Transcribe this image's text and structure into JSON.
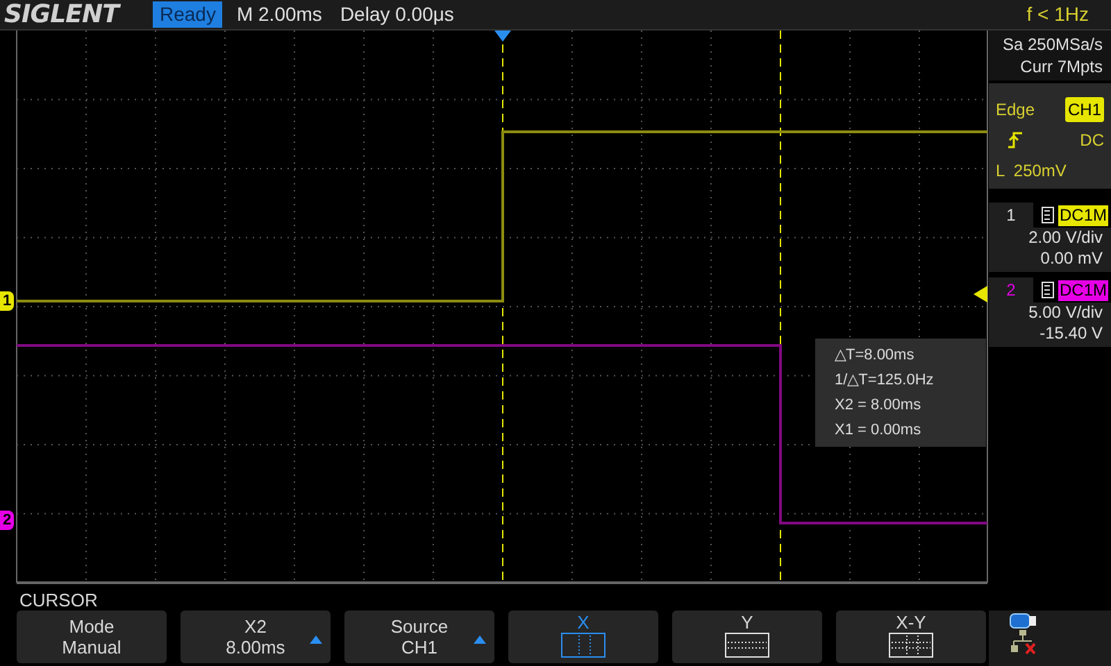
{
  "brand": "SIGLENT",
  "status": "Ready",
  "timebase": "M 2.00ms",
  "delay": "Delay 0.00μs",
  "frequency": "f < 1Hz",
  "acquisition": {
    "sample_rate": "Sa 250MSa/s",
    "memory": "Curr 7Mpts"
  },
  "trigger": {
    "type": "Edge",
    "source": "CH1",
    "coupling": "DC",
    "level": "L  250mV"
  },
  "channels": [
    {
      "number": "1",
      "marker": "1",
      "coupling": "DC1M",
      "scale": "2.00 V/div",
      "offset": "0.00 mV",
      "color": "#e6e600"
    },
    {
      "number": "2",
      "marker": "2",
      "coupling": "DC1M",
      "scale": "5.00 V/div",
      "offset": "-15.40 V",
      "color": "#e600e6"
    }
  ],
  "measurements": [
    "△T=8.00ms",
    "1/△T=125.0Hz",
    "X2 = 8.00ms",
    "X1 = 0.00ms"
  ],
  "menu": {
    "title": "CURSOR",
    "softkeys": [
      {
        "kind": "value",
        "label": "Mode",
        "value": "Manual",
        "adjustable": false
      },
      {
        "kind": "value",
        "label": "X2",
        "value": "8.00ms",
        "adjustable": true
      },
      {
        "kind": "value",
        "label": "Source",
        "value": "CH1",
        "adjustable": true
      },
      {
        "kind": "x-lines",
        "label": "X",
        "selected": true
      },
      {
        "kind": "y-lines",
        "label": "Y",
        "selected": false
      },
      {
        "kind": "xy-lines",
        "label": "X-Y",
        "selected": false
      }
    ]
  }
}
